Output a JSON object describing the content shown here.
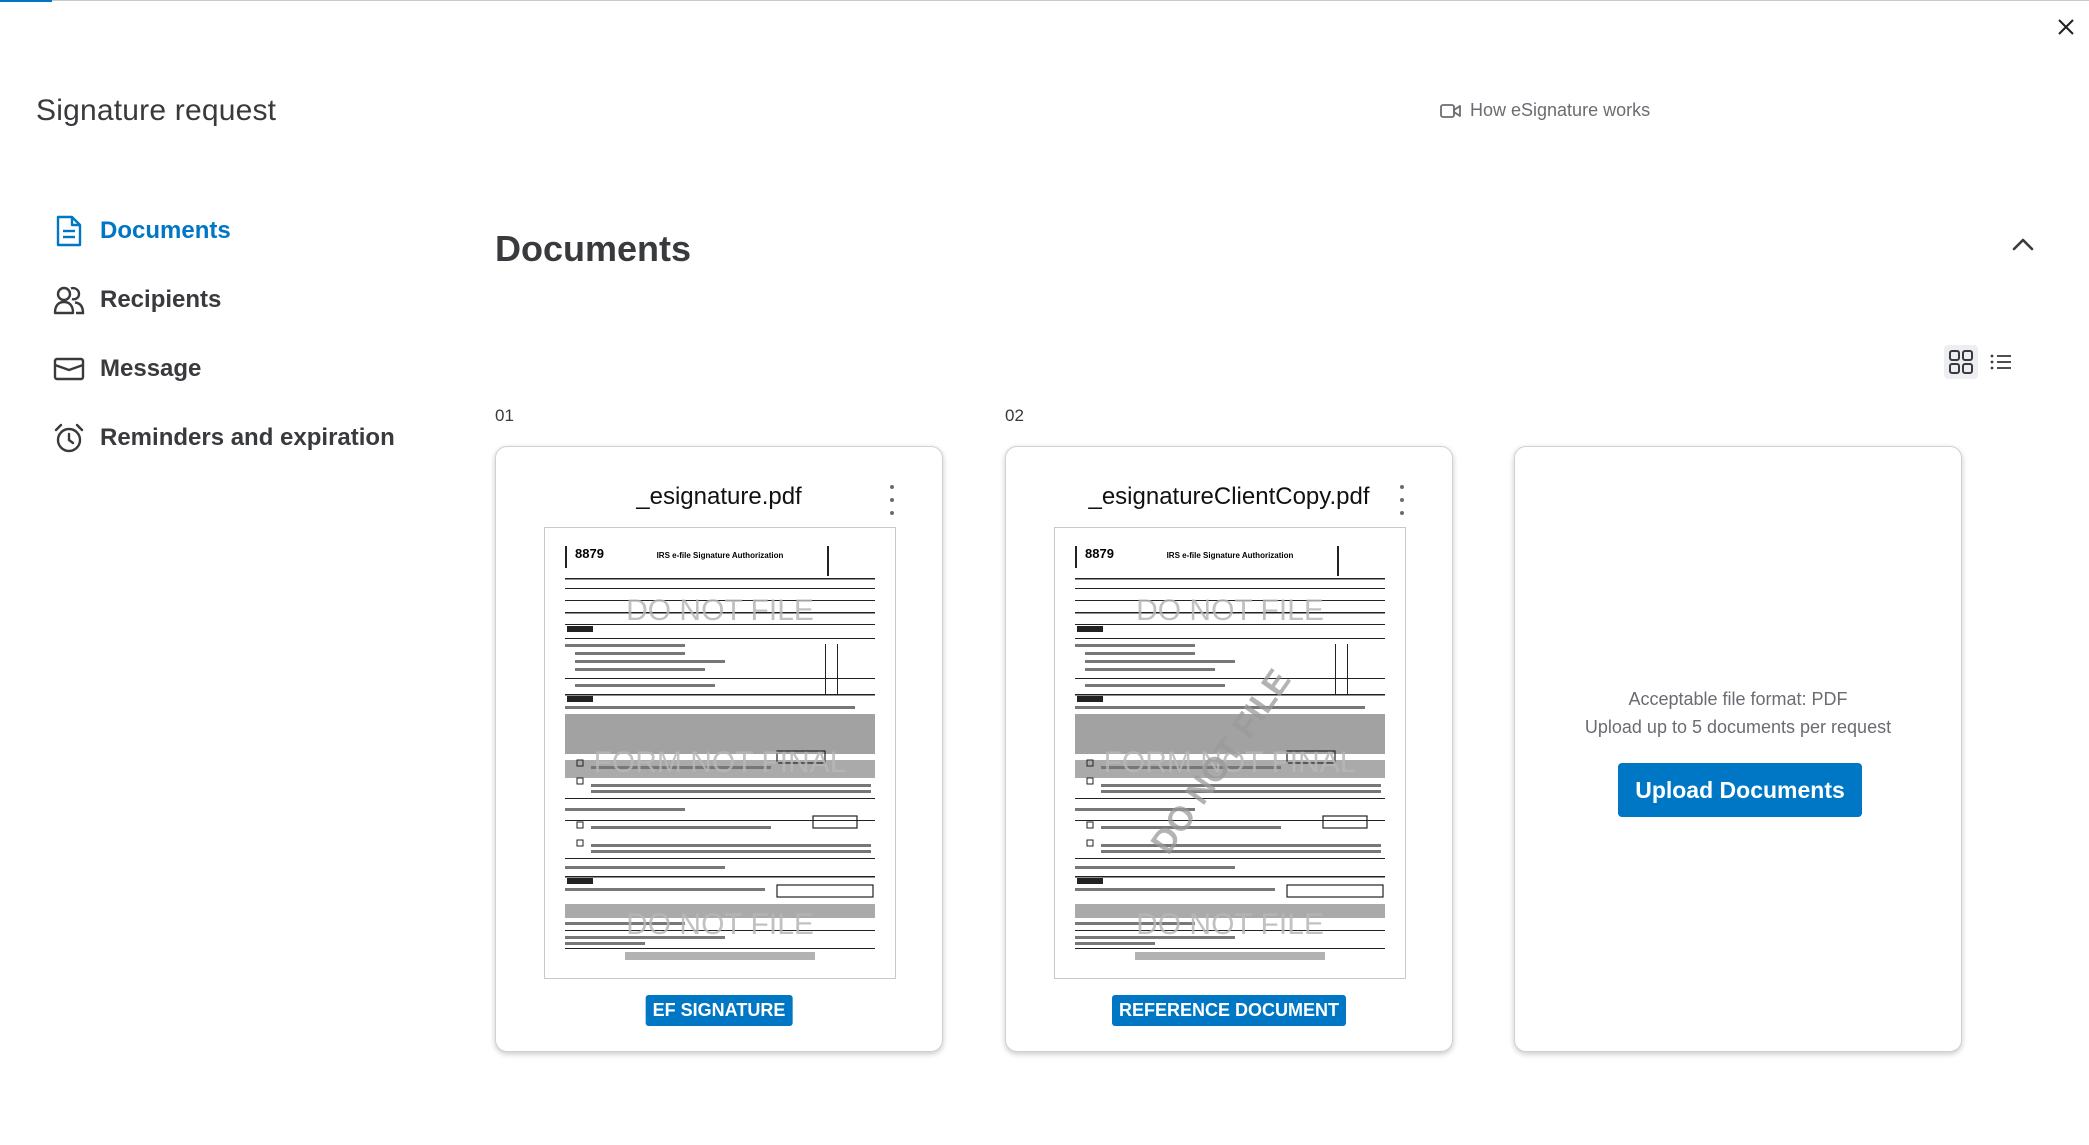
{
  "window": {
    "close_label": "Close"
  },
  "title": "Signature request",
  "help_link": {
    "label": "How eSignature works",
    "icon": "video-icon"
  },
  "nav": {
    "items": [
      {
        "label": "Documents",
        "icon": "document-icon",
        "active": true
      },
      {
        "label": "Recipients",
        "icon": "people-icon",
        "active": false
      },
      {
        "label": "Message",
        "icon": "envelope-icon",
        "active": false
      },
      {
        "label": "Reminders and expiration",
        "icon": "alarm-clock-icon",
        "active": false
      }
    ]
  },
  "section": {
    "title": "Documents",
    "collapse_icon": "chevron-up-icon"
  },
  "view_toggle": {
    "grid_icon": "grid-view-icon",
    "list_icon": "list-view-icon",
    "selected": "grid"
  },
  "documents": [
    {
      "index": "01",
      "filename": "_esignature.pdf",
      "badge": "EF SIGNATURE",
      "thumbnail": {
        "form_number": "8879",
        "form_title": "IRS e-file Signature Authorization",
        "watermarks": [
          "DO NOT FILE",
          "FORM NOT FINAL",
          "DO NOT FILE"
        ]
      }
    },
    {
      "index": "02",
      "filename": "_esignatureClientCopy.pdf",
      "badge": "REFERENCE DOCUMENT",
      "thumbnail": {
        "form_number": "8879",
        "form_title": "IRS e-file Signature Authorization",
        "watermarks": [
          "DO NOT FILE",
          "FORM NOT FINAL",
          "DO NOT FILE"
        ],
        "diagonal_watermark": "DO NOT FILE"
      }
    }
  ],
  "upload": {
    "format_text": "Acceptable file format: PDF",
    "limit_text": "Upload up to 5 documents per request",
    "button_label": "Upload Documents"
  },
  "colors": {
    "accent": "#0077c5",
    "text": "#393a3d",
    "muted": "#6b6c72"
  }
}
